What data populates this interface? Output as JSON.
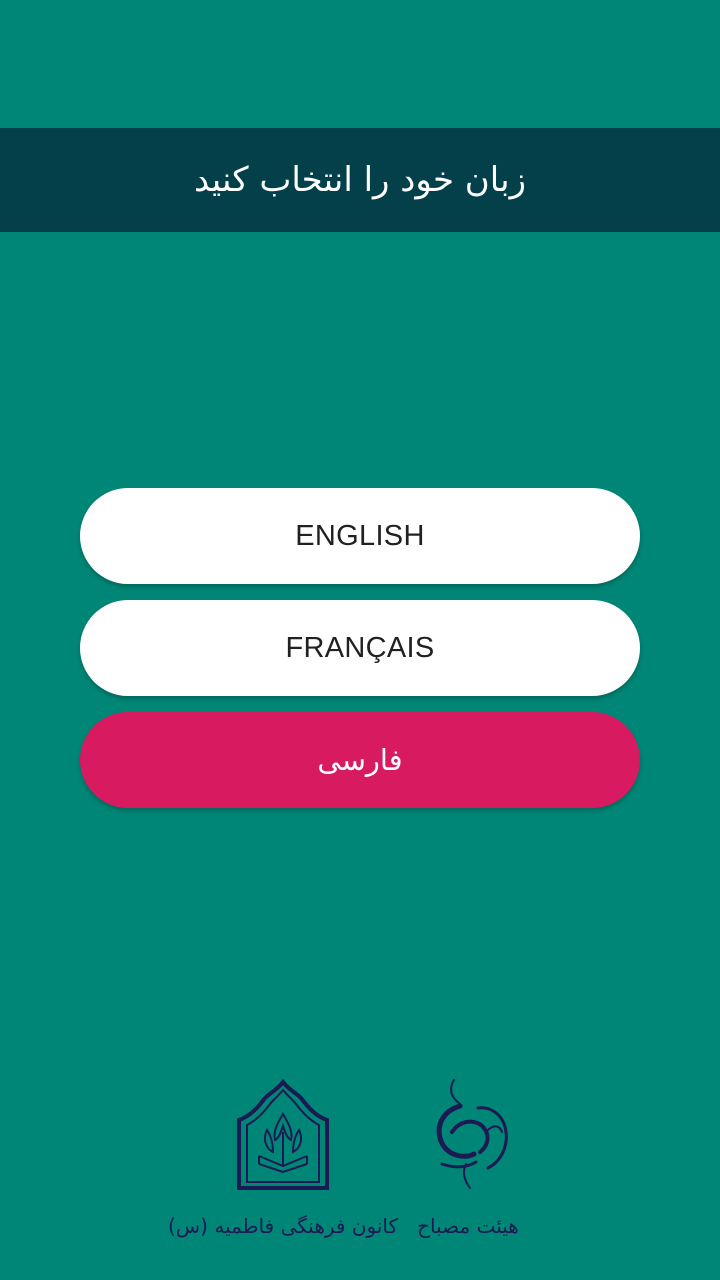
{
  "header": {
    "title": "زبان خود را انتخاب کنید"
  },
  "languages": [
    {
      "label": "ENGLISH",
      "selected": false
    },
    {
      "label": "FRANÇAIS",
      "selected": false
    },
    {
      "label": "فارسی",
      "selected": true
    }
  ],
  "colors": {
    "background": "#008676",
    "header": "#03404a",
    "button": "#ffffff",
    "selected_button": "#d81b60",
    "logo_ink": "#1c1a52"
  },
  "logos": [
    {
      "name": "kanoon-farhangi-fatemieh-logo",
      "caption": "کانون فرهنگی فاطمیه (س)"
    },
    {
      "name": "heyat-mesbah-logo",
      "caption": "هیئت مصباح"
    }
  ]
}
